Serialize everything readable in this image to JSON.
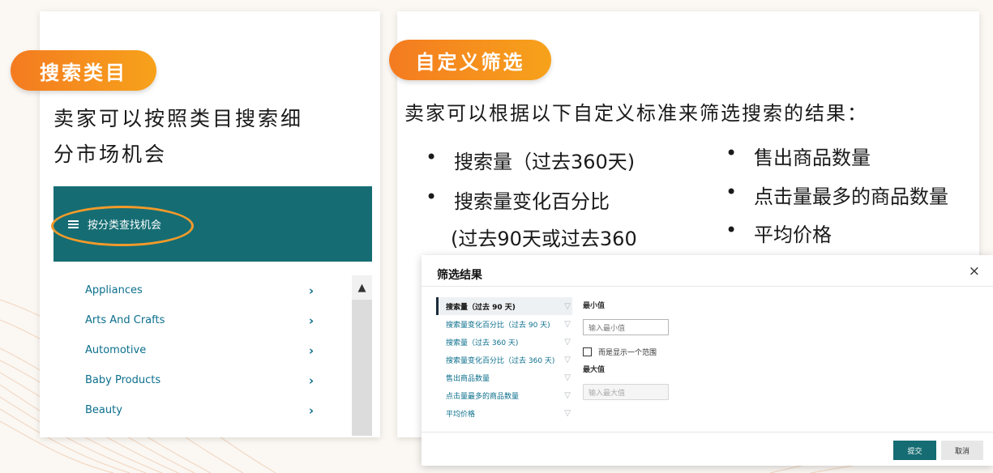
{
  "left_card": {
    "tag": "搜索类目",
    "desc_line1": "卖家可以按照类目搜索细",
    "desc_line2": "分市场机会",
    "menu_label": "按分类查找机会",
    "categories": [
      "Appliances",
      "Arts And Crafts",
      "Automotive",
      "Baby Products",
      "Beauty"
    ],
    "chevron": "›"
  },
  "right_card": {
    "tag": "自定义筛选",
    "desc": "卖家可以根据以下自定义标准来筛选搜索的结果：",
    "bullets_left": [
      "搜索量（过去360天)",
      "搜索量变化百分比",
      "(过去90天或过去360"
    ],
    "bullets_right": [
      "售出商品数量",
      "点击量最多的商品数量",
      "平均价格"
    ]
  },
  "dialog": {
    "title": "筛选结果",
    "close": "×",
    "filters": [
      "搜索量（过去 90 天)",
      "搜索量变化百分比（过去 90 天)",
      "搜索量（过去 360 天)",
      "搜索量变化百分比（过去 360 天)",
      "售出商品数量",
      "点击量最多的商品数量",
      "平均价格"
    ],
    "min_label": "最小值",
    "min_placeholder": "输入最小值",
    "range_label": "而是显示一个范围",
    "max_label": "最大值",
    "max_placeholder": "输入最大值",
    "submit": "提交",
    "cancel": "取消"
  },
  "colors": {
    "accent_orange": "#f47b20",
    "teal": "#156d73",
    "link": "#0b6f8c"
  }
}
